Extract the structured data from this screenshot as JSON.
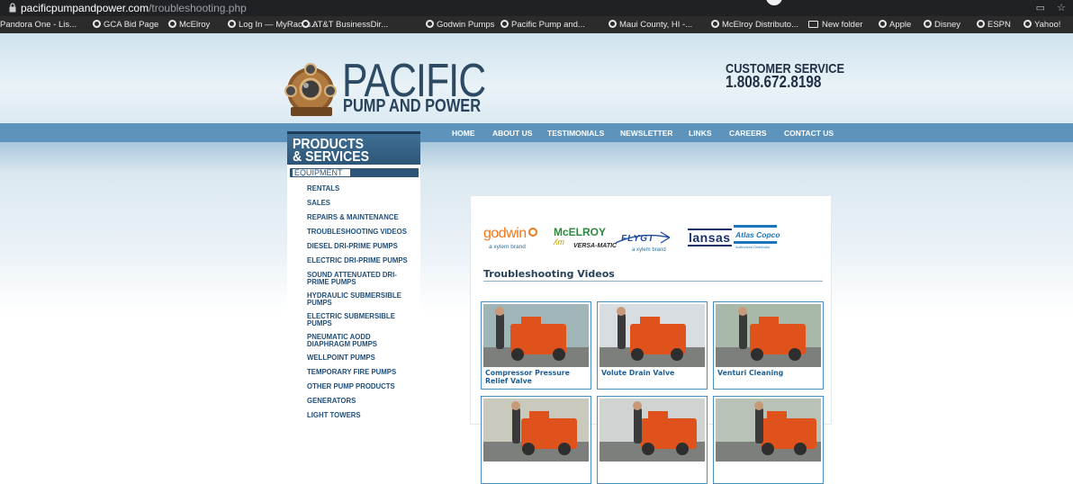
{
  "browser": {
    "url_host": "pacificpumpandpower.com",
    "url_path": "/troubleshooting.php",
    "bookmarks": [
      {
        "label": "Pandora One - Lis..."
      },
      {
        "label": "GCA Bid Page"
      },
      {
        "label": "McElroy"
      },
      {
        "label": "Log In — MyRacks..."
      },
      {
        "label": "AT&T BusinessDir..."
      },
      {
        "label": "Godwin Pumps"
      },
      {
        "label": "Pacific Pump and..."
      },
      {
        "label": "Maui County, HI -..."
      },
      {
        "label": "McElroy Distributo..."
      },
      {
        "label": "New folder"
      },
      {
        "label": "Apple"
      },
      {
        "label": "Disney"
      },
      {
        "label": "ESPN"
      },
      {
        "label": "Yahoo!"
      }
    ]
  },
  "header": {
    "brand": "PACIFIC",
    "brand_sub": "PUMP AND POWER",
    "cs_label": "CUSTOMER SERVICE",
    "cs_phone": "1.808.672.8198"
  },
  "nav": [
    "HOME",
    "ABOUT US",
    "TESTIMONIALS",
    "NEWSLETTER",
    "LINKS",
    "CAREERS",
    "CONTACT US"
  ],
  "sidebar": {
    "title_line1": "PRODUCTS",
    "title_line2": "& SERVICES",
    "section": "EQUIPMENT",
    "items": [
      [
        "RENTALS"
      ],
      [
        "SALES"
      ],
      [
        "REPAIRS & MAINTENANCE"
      ],
      [
        "TROUBLESHOOTING VIDEOS"
      ],
      [
        "DIESEL DRI-PRIME PUMPS"
      ],
      [
        "ELECTRIC DRI-PRIME PUMPS"
      ],
      [
        "SOUND ATTENUATED DRI-",
        "PRIME PUMPS"
      ],
      [
        "HYDRAULIC SUBMERSIBLE",
        "PUMPS"
      ],
      [
        "ELECTRIC SUBMERSIBLE",
        "PUMPS"
      ],
      [
        "PNEUMATIC AODD",
        "DIAPHRAGM PUMPS"
      ],
      [
        "WELLPOINT PUMPS"
      ],
      [
        "TEMPORARY FIRE PUMPS"
      ],
      [
        "OTHER PUMP PRODUCTS"
      ],
      [
        "GENERATORS"
      ],
      [
        "LIGHT TOWERS"
      ]
    ]
  },
  "partners": {
    "godwin": "godwin",
    "godwin_tag": "a xylem brand",
    "mcelroy": "McELROY",
    "versa": "VERSA-MATIC",
    "flygt": "FLYGT",
    "flygt_tag": "a xylem brand",
    "lansas": "lansas",
    "atlas": "Atlas Copco",
    "atlas_tag": "Authorized Distributor"
  },
  "main": {
    "section_title": "Troubleshooting Videos",
    "videos": [
      {
        "caption": "Compressor Pressure Relief Valve"
      },
      {
        "caption": "Volute Drain Valve"
      },
      {
        "caption": "Venturi Cleaning"
      },
      {
        "caption": ""
      },
      {
        "caption": ""
      },
      {
        "caption": ""
      }
    ]
  },
  "colors": {
    "nav_bar": "#5e94bb",
    "sidebar_title": "#2d5678",
    "link": "#1f4f7a",
    "video_border": "#4a8fc4",
    "pump_orange": "#e0521c"
  }
}
